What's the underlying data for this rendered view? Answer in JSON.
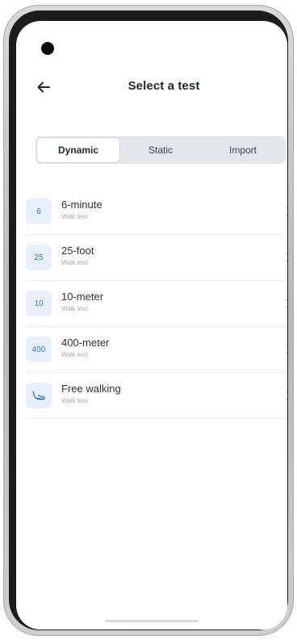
{
  "header": {
    "title": "Select a test",
    "back_icon": "arrow-left-icon"
  },
  "segments": [
    {
      "label": "Dynamic",
      "selected": true
    },
    {
      "label": "Static",
      "selected": false
    },
    {
      "label": "Import",
      "selected": false
    }
  ],
  "tests": [
    {
      "badge": "6",
      "title": "6-minute",
      "subtitle": "Walk test",
      "icon": "chevron-right-icon"
    },
    {
      "badge": "25",
      "title": "25-foot",
      "subtitle": "Walk test",
      "icon": "chevron-right-icon"
    },
    {
      "badge": "10",
      "title": "10-meter",
      "subtitle": "Walk test",
      "icon": "chevron-right-icon"
    },
    {
      "badge": "400",
      "title": "400-meter",
      "subtitle": "Walk test",
      "icon": "chevron-right-icon"
    },
    {
      "badge_icon": "walking-shoe-icon",
      "title": "Free walking",
      "subtitle": "Walk test",
      "icon": "chevron-right-icon"
    }
  ],
  "colors": {
    "accent": "#2f7fd1",
    "badge_bg": "#e8f1fb",
    "segment_bg": "#e3e7ec",
    "text_primary": "#1f2933",
    "text_secondary": "#a3aab2"
  }
}
